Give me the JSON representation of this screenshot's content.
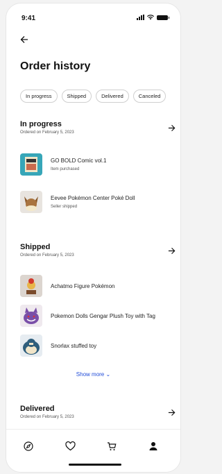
{
  "status_bar": {
    "time": "9:41"
  },
  "header": {
    "back_icon": "arrow-left-icon",
    "title": "Order history"
  },
  "filters": [
    "In progress",
    "Shipped",
    "Delivered",
    "Canceled"
  ],
  "sections": {
    "in_progress": {
      "title": "In progress",
      "subtitle": "Ordered on February 5, 2023",
      "items": [
        {
          "name": "GO BOLD Comic vol.1",
          "status": "Item purchased"
        },
        {
          "name": "Eevee Pokémon Center Poké Doll",
          "status": "Seller shipped"
        }
      ]
    },
    "shipped": {
      "title": "Shipped",
      "subtitle": "Ordered on February 5, 2023",
      "items": [
        {
          "name": "Achatmo Figure Pokémon"
        },
        {
          "name": "Pokemon Dolls Gengar Plush Toy with Tag"
        },
        {
          "name": "Snorlax stuffed toy"
        }
      ],
      "show_more": "Show more ⌄"
    },
    "delivered": {
      "title": "Delivered",
      "subtitle": "Ordered on February 5, 2023"
    }
  },
  "tabbar": {
    "icons": [
      "compass-icon",
      "heart-icon",
      "cart-icon",
      "profile-icon"
    ]
  },
  "colors": {
    "link": "#1f4bd8",
    "text": "#111111",
    "muted": "#555555"
  }
}
